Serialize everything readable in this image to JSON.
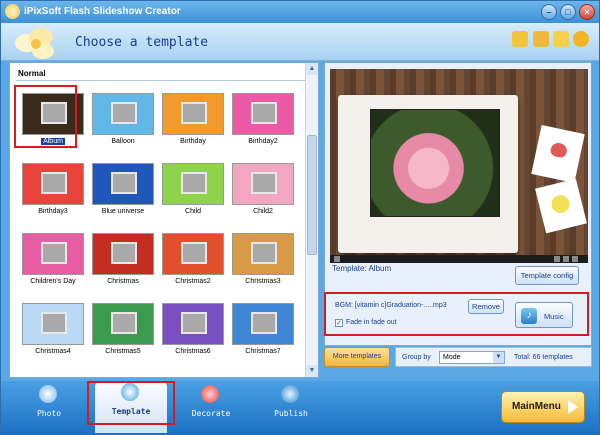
{
  "window": {
    "title": "iPixSoft Flash Slideshow Creator"
  },
  "header": {
    "heading": "Choose a template"
  },
  "gallery": {
    "section": "Normal",
    "templates": [
      {
        "name": "Album",
        "bg": "#3a2a1c",
        "selected": true
      },
      {
        "name": "Balloon",
        "bg": "#62b7e9"
      },
      {
        "name": "Birthday",
        "bg": "#f29a2b"
      },
      {
        "name": "Birthday2",
        "bg": "#ea5aa7"
      },
      {
        "name": "Birthday3",
        "bg": "#e9443b"
      },
      {
        "name": "Blue universe",
        "bg": "#1f58b8"
      },
      {
        "name": "Child",
        "bg": "#8fd34a"
      },
      {
        "name": "Child2",
        "bg": "#f3a6c1"
      },
      {
        "name": "Children's Day",
        "bg": "#e85da3"
      },
      {
        "name": "Christmas",
        "bg": "#c42d22"
      },
      {
        "name": "Christmas2",
        "bg": "#e34f2c"
      },
      {
        "name": "Christmas3",
        "bg": "#d99a46"
      },
      {
        "name": "Christmas4",
        "bg": "#b9d9f4"
      },
      {
        "name": "Christmas5",
        "bg": "#3b9a4d"
      },
      {
        "name": "Christmas6",
        "bg": "#7a4fc2"
      },
      {
        "name": "Christmas7",
        "bg": "#3f86d6"
      }
    ]
  },
  "preview": {
    "template_label": "Template:  Album",
    "template_config_label": "Template config"
  },
  "bgm": {
    "text": "BGM:   [vitamin c]Graduation-.....mp3",
    "remove_label": "Remove",
    "fade_label": "Fade in fade out",
    "fade_checked": true,
    "music_label": "Music"
  },
  "footer_controls": {
    "more_templates_label": "More templates",
    "group_by_label": "Group by",
    "group_by_value": "Mode",
    "total_label": "Total: 66 templates"
  },
  "nav": {
    "photo": "Photo",
    "template": "Template",
    "decorate": "Decorate",
    "publish": "Publish",
    "mainmenu": "MainMenu"
  },
  "colors": {
    "accent": "#1b3d8f",
    "highlight": "#d51b1b"
  }
}
